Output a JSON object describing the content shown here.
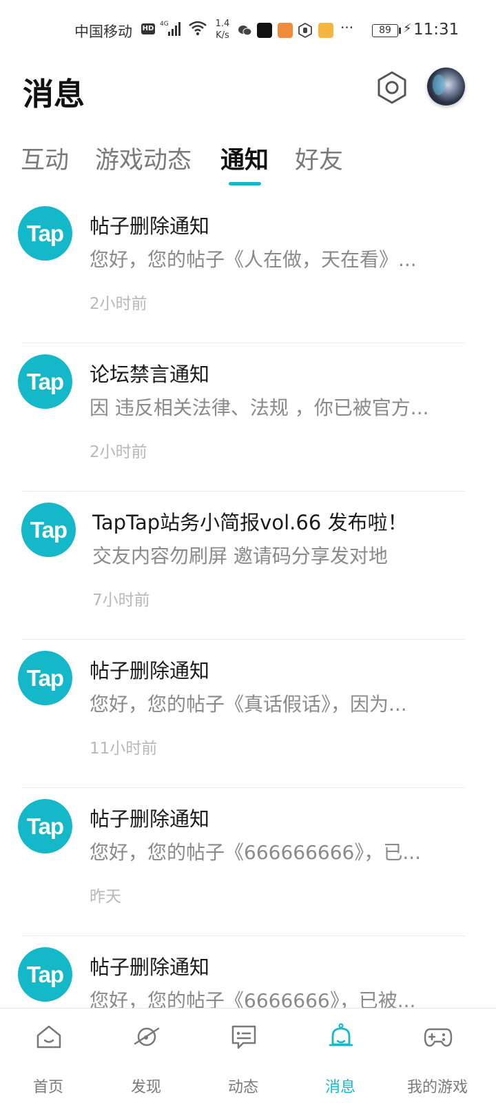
{
  "status_bar": {
    "carrier": "中国移动",
    "hd_badge": "HD",
    "network": "4G",
    "speed_value": "1.4",
    "speed_unit": "K/s",
    "battery": "89",
    "time": "11:31",
    "more": "···"
  },
  "header": {
    "title": "消息"
  },
  "tabs": [
    {
      "label": "互动"
    },
    {
      "label": "游戏动态"
    },
    {
      "label": "通知"
    },
    {
      "label": "好友"
    }
  ],
  "active_tab": "通知",
  "notifications": [
    {
      "logo": "Tap",
      "title": "帖子删除通知",
      "body": "您好，您的帖子《人在做，天在看》...",
      "time": "2小时前"
    },
    {
      "logo": "Tap",
      "title": "论坛禁言通知",
      "body": "因 违反相关法律、法规 ，你已被官方...",
      "time": "2小时前"
    },
    {
      "logo": "Tap",
      "title": "TapTap站务小简报vol.66 发布啦！",
      "body": "交友内容勿刷屏 邀请码分享发对地",
      "time": "7小时前"
    },
    {
      "logo": "Tap",
      "title": "帖子删除通知",
      "body": "您好，您的帖子《真话假话》，因为...",
      "time": "11小时前"
    },
    {
      "logo": "Tap",
      "title": "帖子删除通知",
      "body": "您好，您的帖子《666666666》，已...",
      "time": "昨天"
    },
    {
      "logo": "Tap",
      "title": "帖子删除通知",
      "body": "您好，您的帖子《6666666》，已被...",
      "time": ""
    }
  ],
  "bottom_nav": [
    {
      "label": "首页",
      "icon": "home-icon"
    },
    {
      "label": "发现",
      "icon": "planet-icon"
    },
    {
      "label": "动态",
      "icon": "chat-icon"
    },
    {
      "label": "消息",
      "icon": "bell-icon"
    },
    {
      "label": "我的游戏",
      "icon": "gamepad-icon"
    }
  ],
  "colors": {
    "accent": "#15b8c8",
    "text_primary": "#1a1a1a",
    "text_secondary": "#8a8a8a",
    "text_muted": "#b8b8b8"
  }
}
